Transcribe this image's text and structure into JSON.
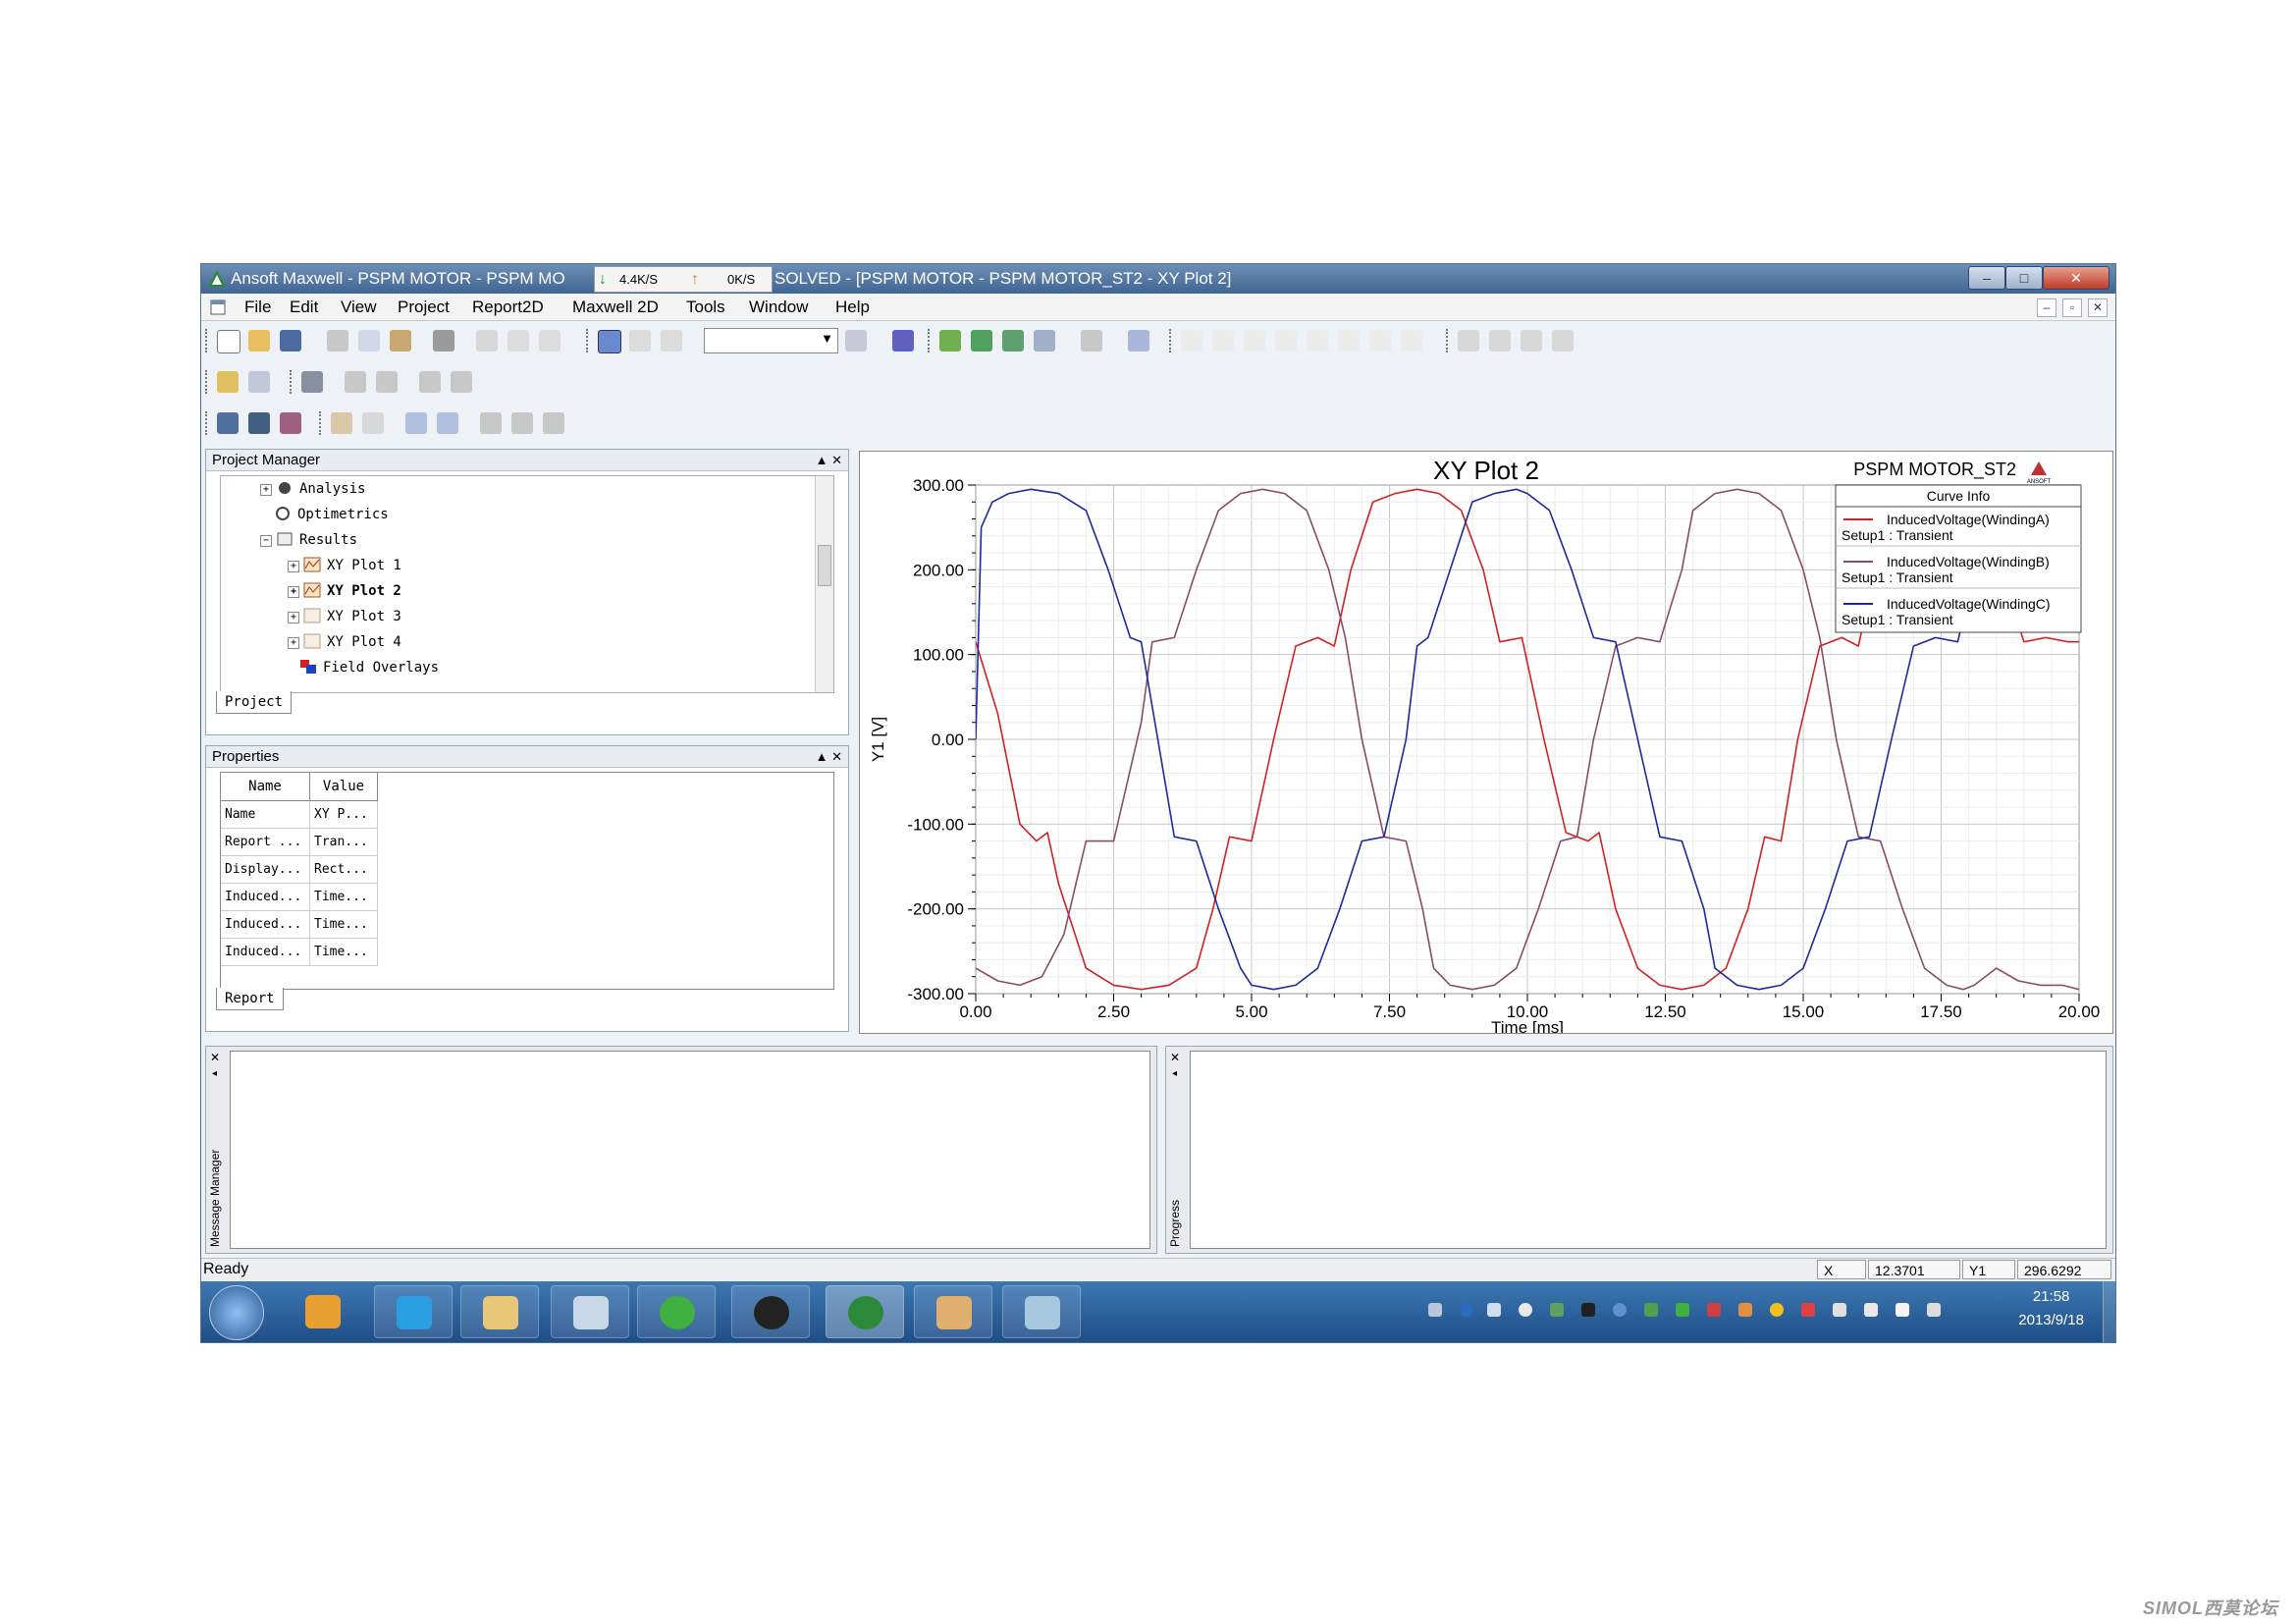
{
  "window": {
    "title_left": "Ansoft Maxwell - PSPM MOTOR - PSPM MO",
    "title_right": "SOLVED - [PSPM MOTOR - PSPM MOTOR_ST2 - XY Plot 2]",
    "speed_down": "4.4K/S",
    "speed_up": "0K/S",
    "buttons": {
      "min": "–",
      "max": "□",
      "close": "✕"
    }
  },
  "menu": {
    "items": [
      "File",
      "Edit",
      "View",
      "Project",
      "Report2D",
      "Maxwell 2D",
      "Tools",
      "Window",
      "Help"
    ]
  },
  "project_manager": {
    "title": "Project Manager",
    "controls": "▲ ✕",
    "tree": [
      {
        "label": "Analysis",
        "icon": "analysis-icon"
      },
      {
        "label": "Optimetrics",
        "icon": "optimetrics-icon"
      },
      {
        "label": "Results",
        "icon": "results-folder-icon"
      },
      {
        "label": "XY Plot 1",
        "icon": "xy-plot-icon"
      },
      {
        "label": "XY Plot 2",
        "icon": "xy-plot-icon"
      },
      {
        "label": "XY Plot 3",
        "icon": "xy-plot-icon"
      },
      {
        "label": "XY Plot 4",
        "icon": "xy-plot-icon"
      },
      {
        "label": "Field Overlays",
        "icon": "field-overlays-icon"
      }
    ],
    "tab": "Project"
  },
  "properties": {
    "title": "Properties",
    "controls": "▲ ✕",
    "headers": [
      "Name",
      "Value"
    ],
    "rows": [
      [
        "Name",
        "XY P..."
      ],
      [
        "Report ...",
        "Tran..."
      ],
      [
        "Display...",
        "Rect..."
      ],
      [
        "Induced...",
        "Time..."
      ],
      [
        "Induced...",
        "Time..."
      ],
      [
        "Induced...",
        "Time..."
      ]
    ],
    "tab": "Report"
  },
  "plot": {
    "title": "XY Plot 2",
    "design": "PSPM MOTOR_ST2",
    "brand": "ANSOFT",
    "legend_title": "Curve Info",
    "legend": [
      {
        "name": "InducedVoltage(WindingA)",
        "sub": "Setup1 : Transient",
        "color": "#d42020"
      },
      {
        "name": "InducedVoltage(WindingB)",
        "sub": "Setup1 : Transient",
        "color": "#8a4a6a"
      },
      {
        "name": "InducedVoltage(WindingC)",
        "sub": "Setup1 : Transient",
        "color": "#1c2a9c"
      }
    ]
  },
  "chart_data": {
    "type": "line",
    "title": "XY Plot 2",
    "xlabel": "Time [ms]",
    "ylabel": "Y1 [V]",
    "xlim": [
      0,
      20
    ],
    "ylim": [
      -300,
      300
    ],
    "xticks": [
      "0.00",
      "2.50",
      "5.00",
      "7.50",
      "10.00",
      "12.50",
      "15.00",
      "17.50",
      "20.00"
    ],
    "yticks": [
      "300.00",
      "200.00",
      "100.00",
      "0.00",
      "-100.00",
      "-200.00",
      "-300.00"
    ],
    "grid": true,
    "legend_position": "top-right",
    "series": [
      {
        "name": "InducedVoltage(WindingA)",
        "color": "#d42020",
        "x": [
          0,
          0.4,
          0.8,
          1.1,
          1.3,
          1.5,
          2.0,
          2.5,
          3.0,
          3.5,
          4.0,
          4.3,
          4.6,
          5.0,
          5.4,
          5.8,
          6.2,
          6.5,
          6.8,
          7.2,
          7.6,
          8.0,
          8.4,
          8.8,
          9.2,
          9.5,
          9.9,
          10.3,
          10.7,
          11.1,
          11.3,
          11.6,
          12.0,
          12.4,
          12.8,
          13.2,
          13.6,
          14.0,
          14.3,
          14.6,
          14.9,
          15.3,
          15.7,
          16.0,
          16.3,
          16.6,
          17.0,
          17.4,
          17.8,
          18.2,
          18.6,
          19.0,
          19.4,
          19.8,
          20.0
        ],
        "y": [
          115,
          30,
          -100,
          -120,
          -110,
          -170,
          -270,
          -290,
          -295,
          -290,
          -270,
          -200,
          -115,
          -120,
          0,
          110,
          120,
          110,
          200,
          280,
          290,
          295,
          290,
          270,
          200,
          115,
          120,
          0,
          -110,
          -120,
          -110,
          -200,
          -270,
          -290,
          -295,
          -290,
          -270,
          -200,
          -115,
          -120,
          0,
          110,
          120,
          110,
          200,
          280,
          290,
          295,
          290,
          270,
          200,
          115,
          120,
          115,
          115
        ]
      },
      {
        "name": "InducedVoltage(WindingB)",
        "color": "#8a4a6a",
        "x": [
          0,
          0.4,
          0.8,
          1.2,
          1.6,
          2.0,
          2.5,
          3.0,
          3.2,
          3.6,
          4.0,
          4.4,
          4.8,
          5.2,
          5.6,
          6.0,
          6.4,
          6.7,
          7.0,
          7.4,
          7.8,
          8.1,
          8.3,
          8.6,
          9.0,
          9.4,
          9.8,
          10.2,
          10.6,
          10.9,
          11.2,
          11.6,
          12.0,
          12.4,
          12.8,
          13.0,
          13.4,
          13.8,
          14.2,
          14.6,
          15.0,
          15.3,
          15.6,
          16.0,
          16.4,
          16.8,
          17.2,
          17.6,
          17.9,
          18.1,
          18.5,
          18.9,
          19.3,
          19.7,
          20.0
        ],
        "y": [
          -270,
          -285,
          -290,
          -280,
          -230,
          -120,
          -120,
          20,
          115,
          120,
          200,
          270,
          290,
          295,
          290,
          270,
          200,
          120,
          0,
          -115,
          -120,
          -200,
          -270,
          -290,
          -295,
          -290,
          -270,
          -200,
          -120,
          -115,
          0,
          110,
          120,
          115,
          200,
          270,
          290,
          295,
          290,
          270,
          200,
          120,
          0,
          -115,
          -120,
          -200,
          -270,
          -290,
          -295,
          -290,
          -270,
          -285,
          -290,
          -290,
          -295
        ]
      },
      {
        "name": "InducedVoltage(WindingC)",
        "color": "#1c2a9c",
        "x": [
          0,
          0.1,
          0.3,
          0.6,
          1.0,
          1.5,
          2.0,
          2.4,
          2.8,
          3.0,
          3.3,
          3.6,
          4.0,
          4.4,
          4.8,
          5.0,
          5.4,
          5.8,
          6.2,
          6.6,
          7.0,
          7.4,
          7.8,
          8.0,
          8.2,
          8.6,
          9.0,
          9.4,
          9.8,
          10.0,
          10.4,
          10.8,
          11.2,
          11.6,
          12.0,
          12.4,
          12.8,
          13.2,
          13.4,
          13.8,
          14.2,
          14.6,
          15.0,
          15.4,
          15.8,
          16.2,
          16.6,
          17.0,
          17.4,
          17.8,
          18.1,
          18.5,
          18.9,
          19.3,
          19.7,
          20.0
        ],
        "y": [
          0,
          250,
          280,
          290,
          295,
          290,
          270,
          200,
          120,
          115,
          0,
          -115,
          -120,
          -200,
          -270,
          -290,
          -295,
          -290,
          -270,
          -200,
          -120,
          -115,
          0,
          110,
          120,
          200,
          280,
          290,
          295,
          290,
          270,
          200,
          120,
          115,
          0,
          -115,
          -120,
          -200,
          -270,
          -290,
          -295,
          -290,
          -270,
          -200,
          -120,
          -115,
          0,
          110,
          120,
          115,
          200,
          270,
          290,
          295,
          290,
          290
        ]
      }
    ]
  },
  "panels": {
    "message_label": "Message Manager",
    "progress_label": "Progress"
  },
  "status": {
    "text": "Ready",
    "x_label": "X",
    "x_value": "12.3701",
    "y_label": "Y1",
    "y_value": "296.6292"
  },
  "taskbar": {
    "time": "21:58",
    "date": "2013/9/18"
  },
  "watermark": "SIMOL西莫论坛"
}
